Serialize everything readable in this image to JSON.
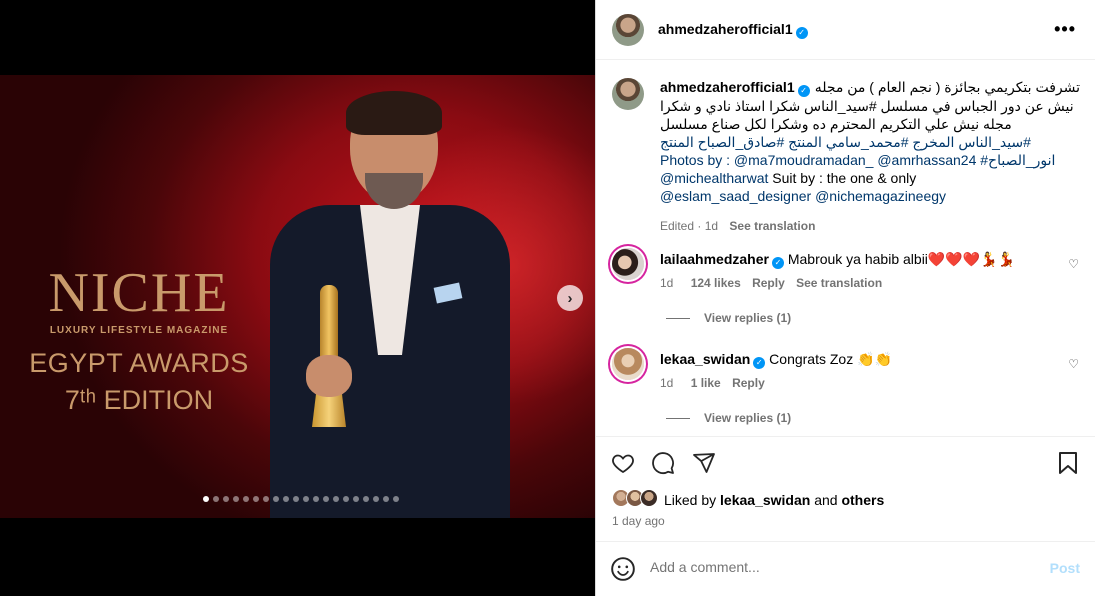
{
  "media": {
    "niche_title": "NICHE",
    "niche_subtitle": "LUXURY LIFESTYLE MAGAZINE",
    "niche_awards": "EGYPT AWARDS",
    "niche_edition": "7ᵗʰ EDITION",
    "carousel_dots": 20,
    "active_dot": 0
  },
  "post": {
    "username": "ahmedzaherofficial1",
    "caption_lines": [
      "تشرفت بتكريمي بجائزة ( نجم العام ) من مجله",
      "نيش عن دور الجباس في مسلسل #سيد_الناس شكرا استاذ نادي و شكرا",
      "مجله نيش علي التكريم المحترم ده وشكرا لكل صناع مسلسل",
      "#سيد_الناس المخرج #محمد_سامي المنتج #صادق_الصباح المنتج"
    ],
    "photos_line": "Photos by : @ma7moudramadan_ @amrhassan24 #انور_الصباح",
    "suit_line_a": "@michealtharwat",
    "suit_line_b": " Suit by : the one & only",
    "designers_line": "@eslam_saad_designer @nichemagazineegy",
    "edited": "Edited · 1d",
    "see_translation": "See translation"
  },
  "comments": [
    {
      "username": "lailaahmedzaher",
      "text": "Mabrouk ya habib albii❤️❤️❤️💃💃",
      "age": "1d",
      "likes": "124 likes",
      "reply": "Reply",
      "see_translation": "See translation",
      "view_replies": "View replies (1)"
    },
    {
      "username": "lekaa_swidan",
      "text": "Congrats Zoz 👏👏",
      "age": "1d",
      "likes": "1 like",
      "reply": "Reply",
      "view_replies": "View replies (1)"
    }
  ],
  "likes": {
    "prefix": "Liked by ",
    "user": "lekaa_swidan",
    "and": " and ",
    "others": "others"
  },
  "time_ago": "1 day ago",
  "comment_box": {
    "placeholder": "Add a comment...",
    "post_label": "Post"
  },
  "colors": {
    "link": "#00376b",
    "verified": "#0095f6",
    "muted": "#737373"
  }
}
